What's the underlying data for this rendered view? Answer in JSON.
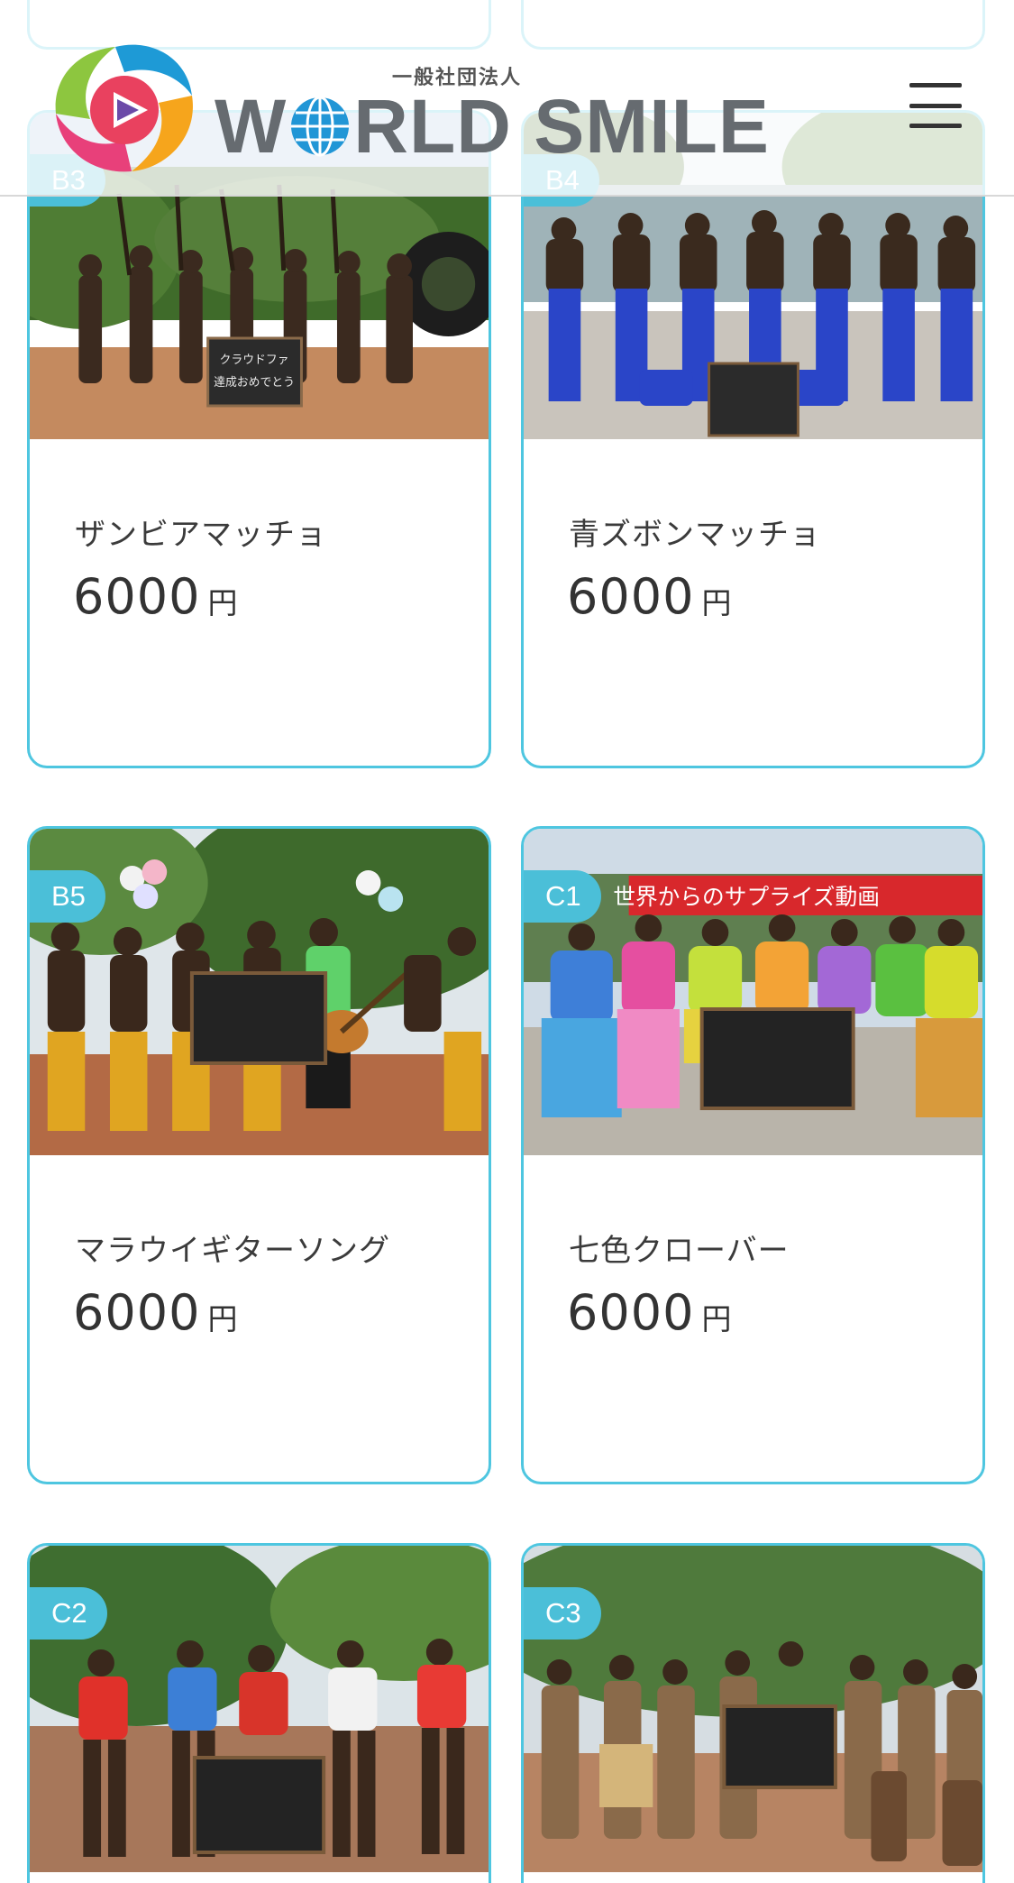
{
  "header": {
    "logo_subtitle": "一般社団法人",
    "logo_title_part1": "W",
    "logo_title_part2": "RLD SMILE",
    "brand_colors": [
      "#1e9ad6",
      "#f6a51c",
      "#e8407a",
      "#8dc63f",
      "#6b4aa8"
    ]
  },
  "top_partial_cards": [
    {
      "id": "above-left"
    },
    {
      "id": "above-right"
    }
  ],
  "products": [
    {
      "badge": "B3",
      "name": "ザンビアマッチョ",
      "price": "6000",
      "unit": "円",
      "sign": "クラウドファ 達成おめでとう"
    },
    {
      "badge": "B4",
      "name": "青ズボンマッチョ",
      "price": "6000",
      "unit": "円",
      "sign": ""
    },
    {
      "badge": "B5",
      "name": "マラウイギターソング",
      "price": "6000",
      "unit": "円",
      "sign": ""
    },
    {
      "badge": "C1",
      "name": "七色クローバー",
      "price": "6000",
      "unit": "円",
      "banner": "世界からのサプライズ動画",
      "sign": ""
    },
    {
      "badge": "C2",
      "name": "",
      "price": "",
      "unit": "",
      "sign": ""
    },
    {
      "badge": "C3",
      "name": "",
      "price": "",
      "unit": "",
      "sign": ""
    }
  ],
  "colors": {
    "card_border": "#4ec6e0",
    "badge_bg": "#4bbfd8",
    "text": "#333333"
  }
}
